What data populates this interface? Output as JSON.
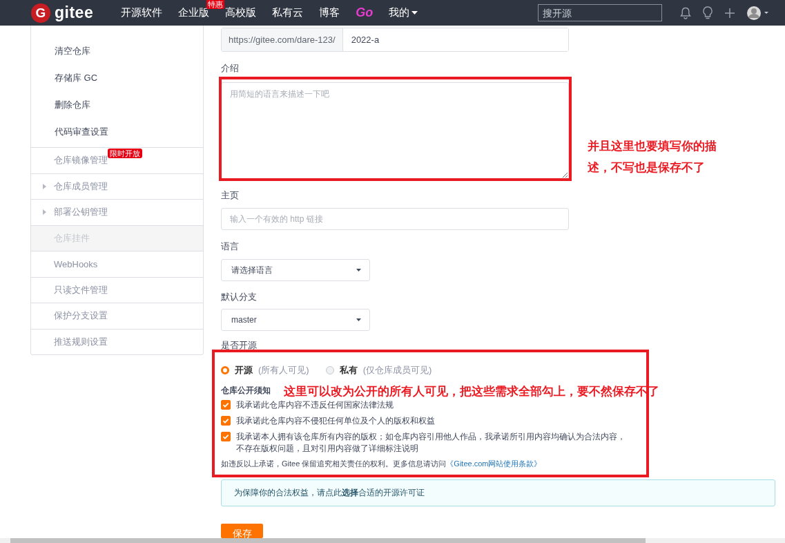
{
  "navbar": {
    "logo_mark": "G",
    "logo_text": "gitee",
    "items": [
      {
        "label": "开源软件",
        "kind": "link"
      },
      {
        "label": "企业版",
        "kind": "link",
        "badge": "特惠"
      },
      {
        "label": "高校版",
        "kind": "link"
      },
      {
        "label": "私有云",
        "kind": "link"
      },
      {
        "label": "博客",
        "kind": "link"
      },
      {
        "label": "Go",
        "kind": "brand"
      },
      {
        "label": "我的",
        "kind": "dropdown"
      }
    ],
    "search": {
      "placeholder": "搜开源"
    }
  },
  "sidebar": {
    "items": [
      {
        "label": "清空仓库",
        "kind": "sub",
        "disabled": false
      },
      {
        "label": "存储库 GC",
        "kind": "sub",
        "disabled": false
      },
      {
        "label": "删除仓库",
        "kind": "sub",
        "disabled": false
      },
      {
        "label": "代码审查设置",
        "kind": "sub",
        "disabled": false
      },
      {
        "label": "仓库镜像管理",
        "kind": "item",
        "badge": "限时开放",
        "disabled": false
      },
      {
        "label": "仓库成员管理",
        "kind": "group",
        "disabled": false
      },
      {
        "label": "部署公钥管理",
        "kind": "group",
        "disabled": false
      },
      {
        "label": "仓库挂件",
        "kind": "item",
        "disabled": true
      },
      {
        "label": "WebHooks",
        "kind": "item",
        "disabled": false
      },
      {
        "label": "只读文件管理",
        "kind": "item",
        "disabled": false
      },
      {
        "label": "保护分支设置",
        "kind": "item",
        "disabled": false
      },
      {
        "label": "推送规则设置",
        "kind": "item",
        "disabled": false
      }
    ]
  },
  "form": {
    "path": {
      "prefix": "https://gitee.com/dare-123/",
      "value": "2022-a"
    },
    "description": {
      "label": "介绍",
      "placeholder": "用简短的语言来描述一下吧"
    },
    "homepage": {
      "label": "主页",
      "placeholder": "输入一个有效的 http 链接"
    },
    "language": {
      "label": "语言",
      "value": "请选择语言"
    },
    "branch": {
      "label": "默认分支",
      "value": "master"
    },
    "visibility": {
      "label": "是否开源",
      "options": [
        {
          "label": "开源",
          "hint": "(所有人可见)",
          "selected": true
        },
        {
          "label": "私有",
          "hint": "(仅仓库成员可见)",
          "selected": false
        }
      ]
    },
    "notice": {
      "title": "仓库公开须知",
      "items": [
        {
          "text": "我承诺此仓库内容不违反任何国家法律法规",
          "checked": true
        },
        {
          "text": "我承诺此仓库内容不侵犯任何单位及个人的版权和权益",
          "checked": true
        },
        {
          "text": "我承诺本人拥有该仓库所有内容的版权；如仓库内容引用他人作品，我承诺所引用内容均确认为合法内容，不存在版权问题，且对引用内容做了详细标注说明",
          "checked": true
        }
      ],
      "footer": "如违反以上承诺，Gitee 保留追究相关责任的权利。更多信息请访问",
      "footer_link": "《Gitee.com网站使用条款》"
    },
    "license_tip": "为保障你的合法权益，请点此 **选择** 合适的开源许可证",
    "save_button": "保存"
  },
  "annotations": [
    {
      "text": "并且这里也要填写你的描述，不写也是保存不了"
    },
    {
      "text": "这里可以改为公开的所有人可见，把这些需求全部勾上，要不然保存不了"
    }
  ]
}
